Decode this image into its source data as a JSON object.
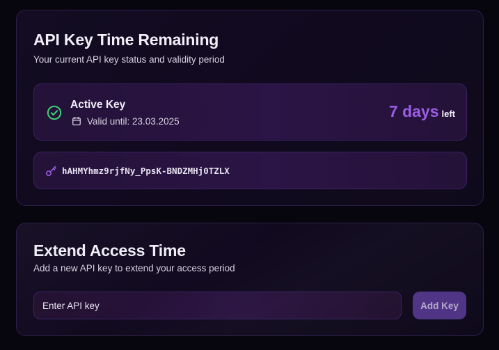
{
  "api_key_card": {
    "title": "API Key Time Remaining",
    "subtitle": "Your current API key status and validity period",
    "status": {
      "label": "Active Key",
      "status_icon": "check-circle-icon",
      "calendar_icon": "calendar-icon",
      "valid_until": "Valid until: 23.03.2025",
      "days_value": "7 days",
      "days_suffix": "left",
      "accent_color": "#9b5de5",
      "status_color": "#3ecf74"
    },
    "key": {
      "icon": "key-icon",
      "value": "hAHMYhmz9rjfNy_PpsK-BNDZMHj0TZLX"
    }
  },
  "extend_card": {
    "title": "Extend Access Time",
    "subtitle": "Add a new API key to extend your access period",
    "input": {
      "placeholder": "Enter API key",
      "value": ""
    },
    "add_button_label": "Add Key"
  }
}
